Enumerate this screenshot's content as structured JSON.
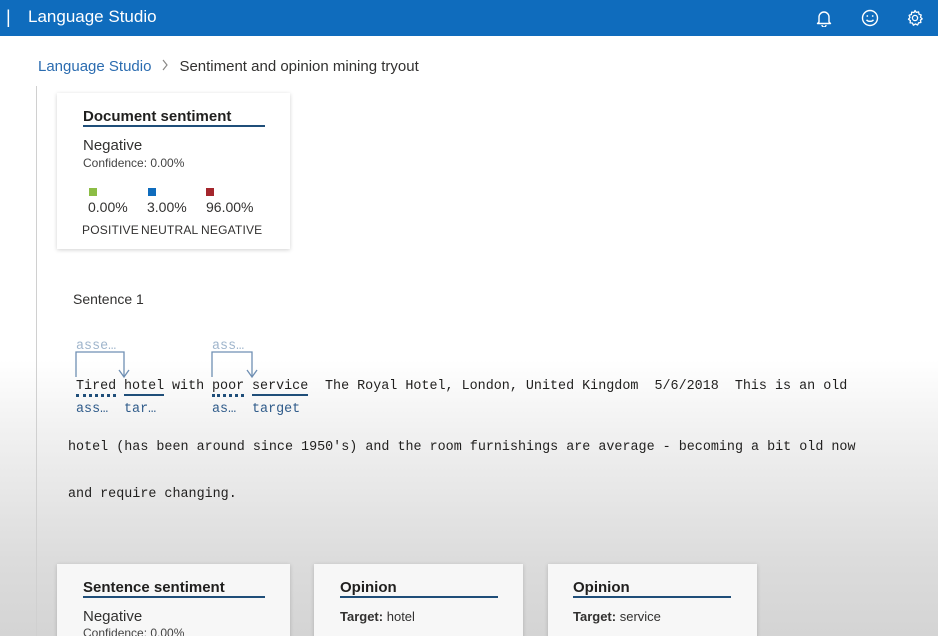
{
  "header": {
    "pipe": "|",
    "title": "Language Studio",
    "icons": [
      "bell-icon",
      "smiley-icon",
      "gear-icon"
    ]
  },
  "breadcrumb": {
    "root": "Language Studio",
    "current": "Sentiment and opinion mining tryout"
  },
  "document_sentiment": {
    "title": "Document sentiment",
    "label": "Negative",
    "confidence": "Confidence: 0.00%",
    "scores": [
      {
        "percent": "0.00%",
        "category": "POSITIVE",
        "color": "#8cbd45"
      },
      {
        "percent": "3.00%",
        "category": "NEUTRAL",
        "color": "#0f6cbd"
      },
      {
        "percent": "96.00%",
        "category": "NEGATIVE",
        "color": "#a4262c"
      }
    ]
  },
  "sentence": {
    "heading": "Sentence 1",
    "words": {
      "tired": "Tired",
      "hotel": "hotel",
      "with": "with",
      "poor": "poor",
      "service": "service",
      "rest_line1": "The Royal Hotel, London, United Kingdom  5/6/2018  This is an old"
    },
    "line2": "hotel (has been around since 1950's) and the room furnishings are average - becoming a bit old now",
    "line3": "and require changing.",
    "annotations_top": [
      "asse…",
      "ass…"
    ],
    "annotations_bottom": [
      "ass…",
      "tar…",
      "as…",
      "target"
    ]
  },
  "sentence_sentiment": {
    "title": "Sentence sentiment",
    "label": "Negative",
    "confidence": "Confidence: 0.00%"
  },
  "opinions": [
    {
      "title": "Opinion",
      "target_label": "Target:",
      "target_value": "hotel"
    },
    {
      "title": "Opinion",
      "target_label": "Target:",
      "target_value": "service"
    }
  ]
}
